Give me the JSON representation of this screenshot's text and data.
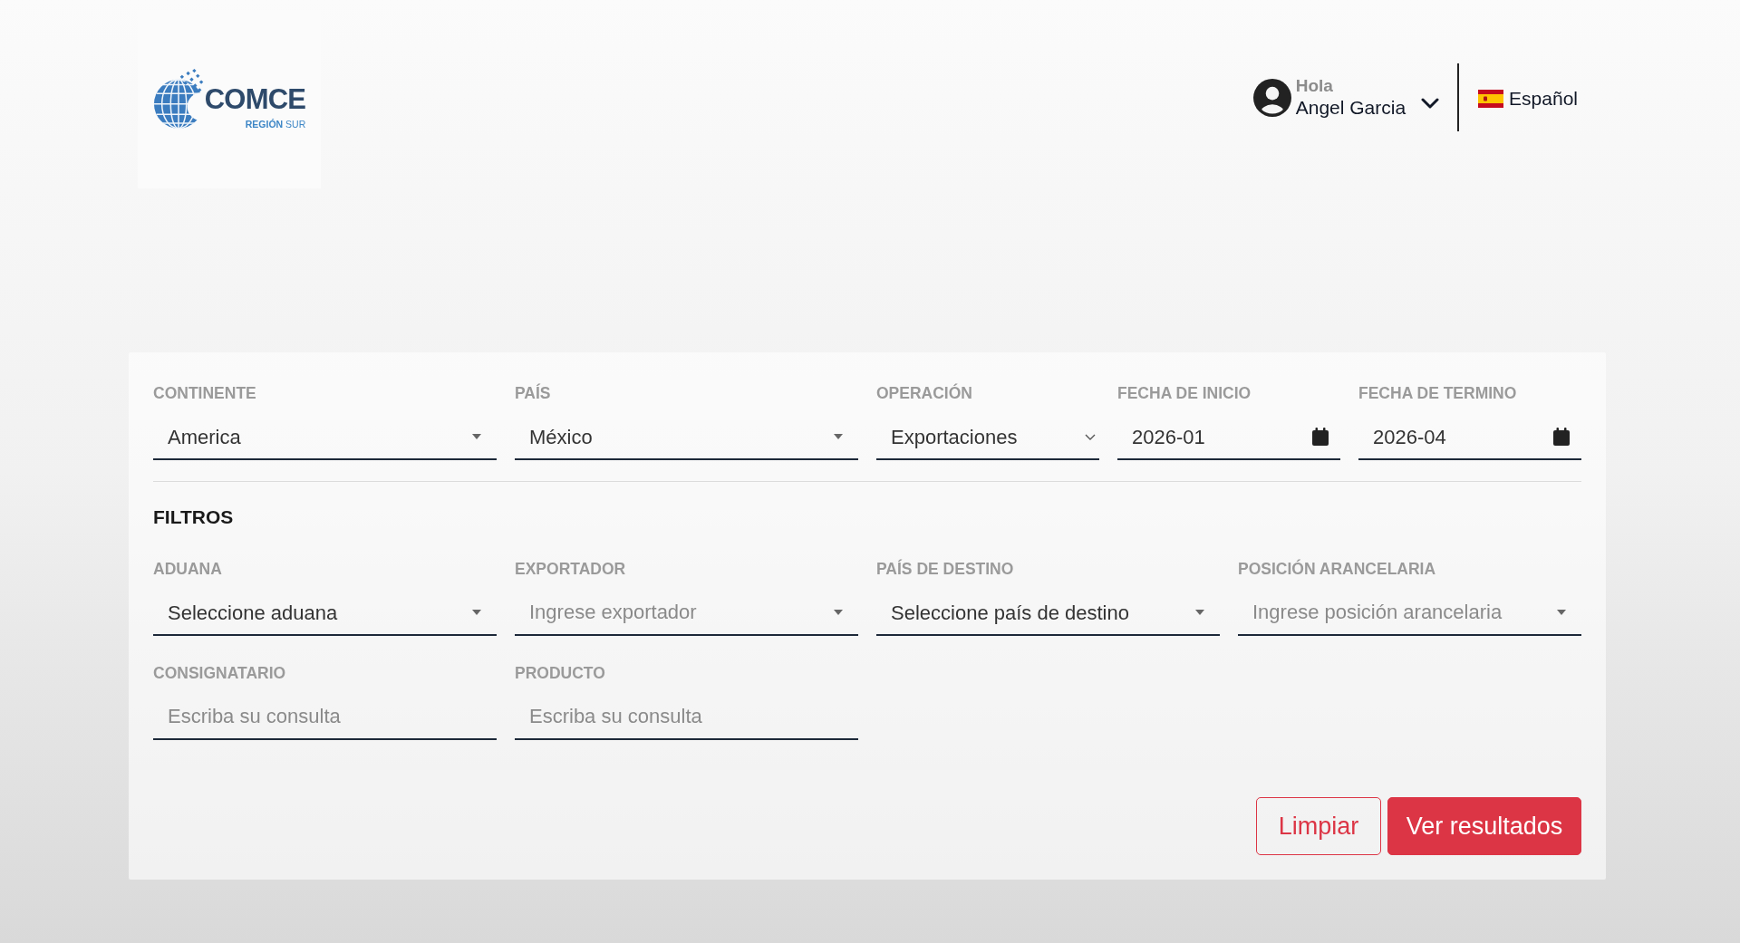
{
  "header": {
    "logo": {
      "name": "COMCE",
      "tagline": "**REGIÓN** SUR"
    },
    "user": {
      "greeting": "Hola",
      "name": "Angel Garcia"
    },
    "language": {
      "label": "Español"
    }
  },
  "search": {
    "fields": [
      {
        "label": "CONTINENTE",
        "kind": "select",
        "value": "America"
      },
      {
        "label": "PAÍS",
        "kind": "select",
        "value": "México"
      },
      {
        "label": "OPERACIÓN",
        "kind": "dropdown",
        "value": "Exportaciones"
      },
      {
        "label": "FECHA DE INICIO",
        "kind": "month",
        "value": "2026-01"
      },
      {
        "label": "FECHA DE TERMINO",
        "kind": "month",
        "value": "2026-04"
      }
    ]
  },
  "filters": {
    "title": "FILTROS",
    "fields": [
      {
        "label": "ADUANA",
        "kind": "select",
        "value": "Seleccione aduana"
      },
      {
        "label": "EXPORTADOR",
        "kind": "select",
        "placeholder": "Ingrese exportador"
      },
      {
        "label": "PAÍS DE DESTINO",
        "kind": "select",
        "value": "Seleccione país de destino"
      },
      {
        "label": "POSICIÓN ARANCELARIA",
        "kind": "select",
        "placeholder": "Ingrese posición arancelaria"
      },
      {
        "label": "CONSIGNATARIO",
        "kind": "text",
        "placeholder": "Escriba su consulta"
      },
      {
        "label": "PRODUCTO",
        "kind": "text",
        "placeholder": "Escriba su consulta"
      }
    ]
  },
  "actions": [
    {
      "label": "Limpiar",
      "kind": "outline"
    },
    {
      "label": "Ver resultados",
      "kind": "solid"
    }
  ]
}
